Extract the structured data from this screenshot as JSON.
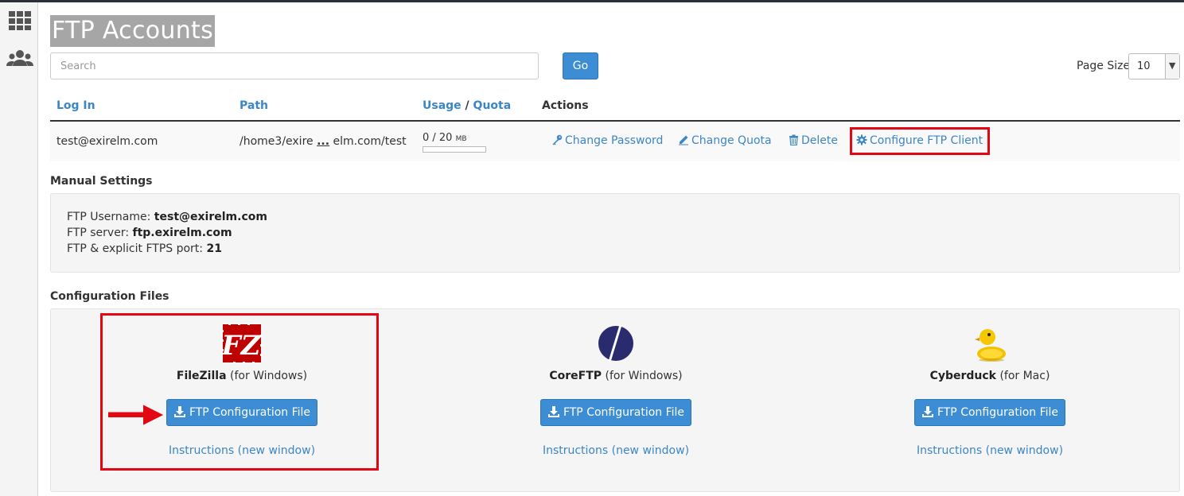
{
  "page": {
    "title": "FTP Accounts"
  },
  "search": {
    "placeholder": "Search",
    "go_label": "Go"
  },
  "page_size": {
    "label": "Page Size",
    "value": "10"
  },
  "table": {
    "headers": {
      "login": "Log In",
      "path": "Path",
      "usage": "Usage",
      "slash": "/",
      "quota": "Quota",
      "actions": "Actions"
    },
    "row": {
      "login": "test@exirelm.com",
      "path_start": "/home3/exire",
      "path_ellipsis": "...",
      "path_end": "elm.com/test",
      "usage_value": "0 / 20",
      "usage_unit": "MB",
      "usage_fraction": 0.0
    },
    "actions": {
      "change_password": "Change Password",
      "change_quota": "Change Quota",
      "delete": "Delete",
      "configure": "Configure FTP Client"
    }
  },
  "manual_settings": {
    "title": "Manual Settings",
    "username_label": "FTP Username:",
    "username_value": "test@exirelm.com",
    "server_label": "FTP server:",
    "server_value": "ftp.exirelm.com",
    "port_label": "FTP & explicit FTPS port:",
    "port_value": "21"
  },
  "config_files": {
    "title": "Configuration Files",
    "clients": [
      {
        "name": "FileZilla",
        "platform": "(for Windows)",
        "button": "FTP Configuration File",
        "link": "Instructions (new window)",
        "icon": "filezilla-logo-icon"
      },
      {
        "name": "CoreFTP",
        "platform": "(for Windows)",
        "button": "FTP Configuration File",
        "link": "Instructions (new window)",
        "icon": "coreftp-logo-icon"
      },
      {
        "name": "Cyberduck",
        "platform": "(for Mac)",
        "button": "FTP Configuration File",
        "link": "Instructions (new window)",
        "icon": "cyberduck-logo-icon"
      }
    ]
  },
  "colors": {
    "accent": "#3c8dd4",
    "link": "#3b86c6",
    "highlight": "#e30613"
  }
}
